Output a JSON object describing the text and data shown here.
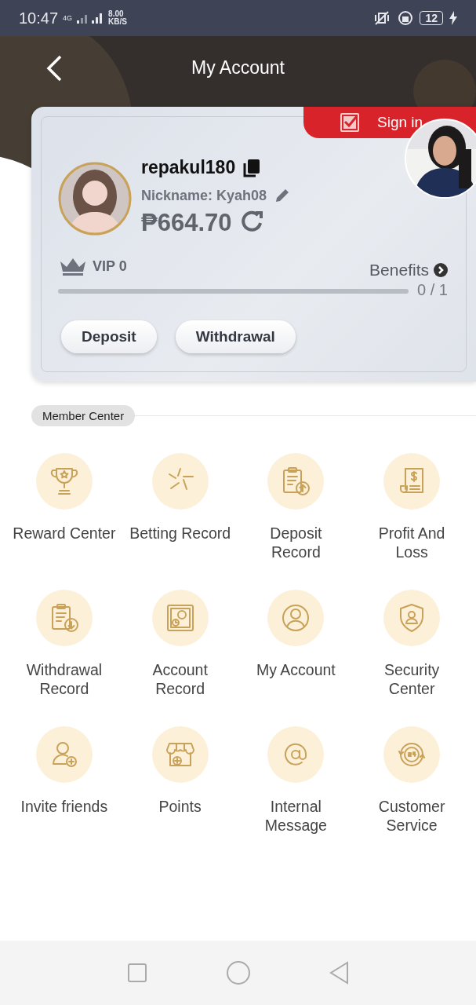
{
  "status_bar": {
    "time": "10:47",
    "network": "4G",
    "speed": "8.00",
    "speed_unit": "KB/S",
    "battery": "12"
  },
  "header": {
    "title": "My Account"
  },
  "account": {
    "sign_in": "Sign in",
    "username": "repakul180",
    "nickname": "Nickname: Kyah08",
    "balance": "₱664.70",
    "vip": "VIP 0",
    "benefits": "Benefits",
    "progress": "0 / 1",
    "level": 0,
    "buttons": [
      "Deposit",
      "Withdrawal"
    ]
  },
  "member_center": {
    "title": "Member Center",
    "items": [
      {
        "label": "Reward Center"
      },
      {
        "label": "Betting Record"
      },
      {
        "label": "Deposit Record"
      },
      {
        "label": "Profit And Loss"
      },
      {
        "label": "Withdrawal Record"
      },
      {
        "label": "Account Record"
      },
      {
        "label": "My Account"
      },
      {
        "label": "Security Center"
      },
      {
        "label": "Invite friends"
      },
      {
        "label": "Points"
      },
      {
        "label": "Internal Message"
      },
      {
        "label": "Customer Service"
      }
    ]
  }
}
